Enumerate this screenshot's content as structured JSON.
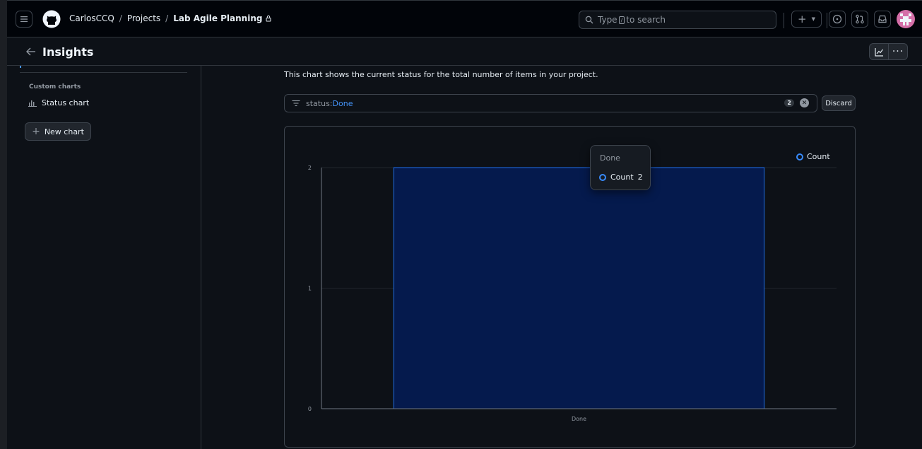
{
  "header": {
    "owner": "CarlosCCQ",
    "projects": "Projects",
    "project": "Lab Agile Planning",
    "search_pre": "Type",
    "search_key": "/",
    "search_post": "to search"
  },
  "subheader": {
    "title": "Insights"
  },
  "sidebar": {
    "section_label": "Custom charts",
    "items": [
      {
        "label": "Status chart"
      }
    ],
    "new_chart": "New chart"
  },
  "main": {
    "description": "This chart shows the current status for the total number of items in your project.",
    "filter": {
      "key": "status:",
      "value": "Done",
      "count": "2"
    },
    "discard": "Discard"
  },
  "tooltip": {
    "title": "Done",
    "series": "Count",
    "value": "2"
  },
  "colors": {
    "bar_fill": "#051a4d",
    "bar_stroke": "#1f6feb",
    "accent": "#388bfd"
  },
  "chart_data": {
    "type": "bar",
    "categories": [
      "Done"
    ],
    "series": [
      {
        "name": "Count",
        "values": [
          2
        ]
      }
    ],
    "yticks": [
      "0",
      "1",
      "2"
    ],
    "ylim": [
      0,
      2
    ],
    "legend": "top-right",
    "grid": true
  }
}
